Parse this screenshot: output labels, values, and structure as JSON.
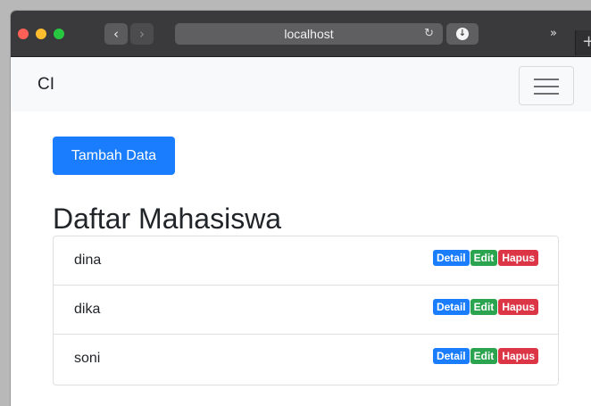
{
  "browser": {
    "url": "localhost",
    "back_glyph": "‹",
    "forward_glyph": "›",
    "reload_glyph": "↻",
    "download_glyph": "↓",
    "more_glyph": "»",
    "newtab_glyph": "+",
    "colors": {
      "close": "#fe5f57",
      "minimize": "#febc2e",
      "maximize": "#28c840"
    }
  },
  "navbar": {
    "brand": "CI"
  },
  "main": {
    "add_button": "Tambah Data",
    "title": "Daftar Mahasiswa",
    "students": [
      {
        "name": "dina",
        "detail": "Detail",
        "edit": "Edit",
        "delete": "Hapus"
      },
      {
        "name": "dika",
        "detail": "Detail",
        "edit": "Edit",
        "delete": "Hapus"
      },
      {
        "name": "soni",
        "detail": "Detail",
        "edit": "Edit",
        "delete": "Hapus"
      }
    ]
  },
  "colors": {
    "primary": "#1a7dfd",
    "success": "#2aa44f",
    "danger": "#dc3545"
  }
}
